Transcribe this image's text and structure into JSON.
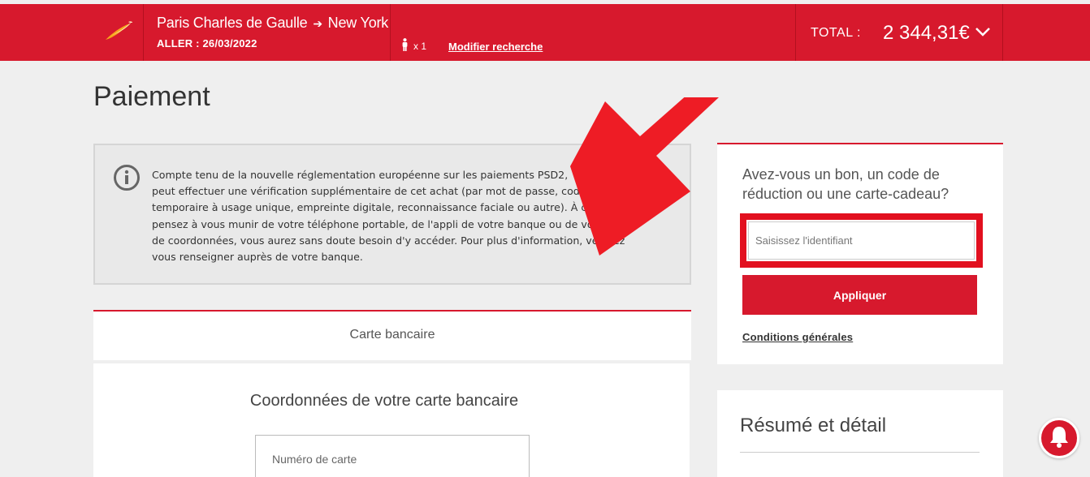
{
  "header": {
    "route_from": "Paris Charles de Gaulle",
    "route_arrow": "➔",
    "route_to": "New York",
    "aller": "ALLER : 26/03/2022",
    "passengers": "x 1",
    "modify_label": "Modifier recherche",
    "total_label": "TOTAL :",
    "total_amount": "2 344,31€"
  },
  "page": {
    "title": "Paiement"
  },
  "info": {
    "text": "Compte tenu de la nouvelle réglementation européenne sur les paiements PSD2, ... peut effectuer une vérification supplémentaire de cet achat (par mot de passe, code temporaire à usage unique, empreinte digitale, reconnaissance faciale ou autre). À cet eff... pensez à vous munir de votre téléphone portable, de l'appli de votre banque ou de votr... arte de coordonnées, vous aurez sans doute besoin d'y accéder. Pour plus d'information, veuillez vous renseigner auprès de votre banque.",
    "lines": [
      "Compte tenu de la nouvelle réglementation européenne sur les paiements PSD2,",
      "peut effectuer une vérification supplémentaire de cet achat (par mot de passe, code",
      "temporaire à usage unique, empreinte digitale, reconnaissance faciale ou autre). À cet ef",
      "pensez à vous munir de votre téléphone portable, de l'appli de votre banque ou de votr   carte",
      "de coordonnées, vous aurez sans doute besoin d'y accéder. Pour plus d'information, veuillez",
      "vous renseigner auprès de votre banque."
    ]
  },
  "card": {
    "tab_label": "Carte bancaire",
    "heading": "Coordonnées de votre carte bancaire",
    "number_placeholder": "Numéro de carte"
  },
  "voucher": {
    "question": "Avez-vous un bon, un code de réduction ou une carte-cadeau?",
    "input_placeholder": "Saisissez l'identifiant",
    "apply_label": "Appliquer",
    "conditions_label": "Conditions générales"
  },
  "summary": {
    "title": "Résumé et détail"
  },
  "colors": {
    "brand_red": "#d7192d",
    "highlight_red": "#e2101f",
    "background": "#efefef"
  },
  "icons": {
    "logo": "airline-logo-icon",
    "passenger": "person-icon",
    "total_toggle": "chevron-down-icon",
    "info": "info-icon",
    "overlay": "arrow-annotation-icon",
    "notification": "bell-icon"
  }
}
